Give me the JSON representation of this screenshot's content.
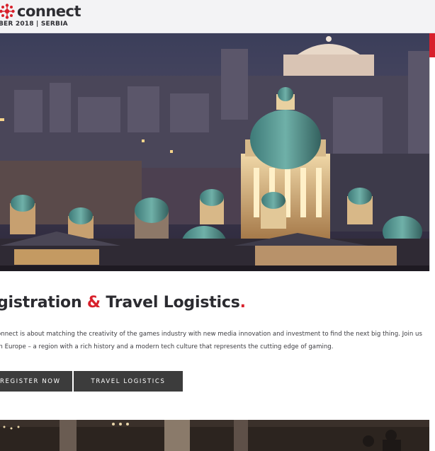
{
  "header": {
    "logo_text": "connect",
    "logo_icon": "asterisk-flower-icon",
    "tagline": "BER 2018 | SERBIA",
    "brand_color": "#d8212c"
  },
  "hero": {
    "image": "belgrade-night-skyline-photo"
  },
  "section": {
    "title_part1": "gistration ",
    "title_amp": "&",
    "title_part2": " Travel Logistics",
    "title_dot": ".",
    "description": "onnect is about matching the creativity of the games industry with new media innovation and investment to find the next big thing. Join us in Europe – a region with a rich history and a modern tech culture that represents the cutting edge of gaming.",
    "register_label": "REGISTER NOW",
    "travel_label": "TRAVEL LOGISTICS"
  },
  "footer": {
    "image": "conference-stage-photo"
  }
}
